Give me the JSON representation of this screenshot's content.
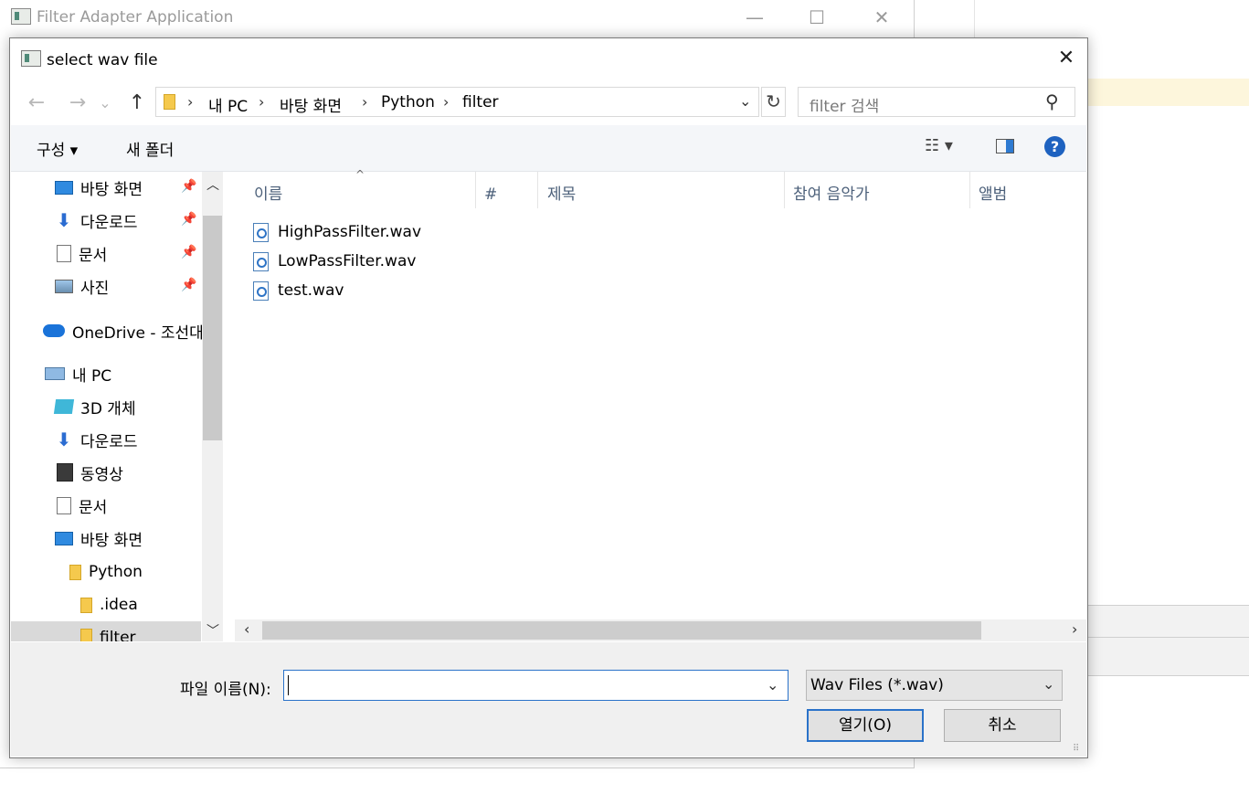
{
  "background_window": {
    "title": "Filter Adapter Application",
    "minimize": "—",
    "maximize": "☐",
    "close": "✕"
  },
  "dialog": {
    "title": "select wav file",
    "close": "✕",
    "nav": {
      "back": "←",
      "forward": "→",
      "recent": "⌄",
      "up": "↑",
      "refresh": "↻",
      "dropdown": "⌄"
    },
    "breadcrumb": [
      "내 PC",
      "바탕 화면",
      "Python",
      "filter"
    ],
    "breadcrumb_sep": "›",
    "search_placeholder": "filter 검색",
    "search_icon": "⚲",
    "toolbar": {
      "organize": "구성 ▾",
      "new_folder": "새 폴더",
      "view": "☷ ▾",
      "help": "?"
    },
    "nav_pane": {
      "quick_access": [
        {
          "label": "바탕 화면",
          "icon": "desktop-icon",
          "pinned": true
        },
        {
          "label": "다운로드",
          "icon": "download-icon",
          "pinned": true
        },
        {
          "label": "문서",
          "icon": "document-icon",
          "pinned": true
        },
        {
          "label": "사진",
          "icon": "pictures-icon",
          "pinned": true
        }
      ],
      "onedrive": "OneDrive - 조선대",
      "this_pc": "내 PC",
      "pc_items": [
        "3D 개체",
        "다운로드",
        "동영상",
        "문서",
        "바탕 화면"
      ],
      "python": "Python",
      "idea": ".idea",
      "filter": "filter",
      "pin_glyph": "📌"
    },
    "columns": [
      "이름",
      "#",
      "제목",
      "참여 음악가",
      "앨범"
    ],
    "sort_indicator": "^",
    "files": [
      "HighPassFilter.wav",
      "LowPassFilter.wav",
      "test.wav"
    ],
    "scroll": {
      "up": "︿",
      "down": "﹀",
      "left": "‹",
      "right": "›"
    },
    "file_name_label": "파일 이름(N):",
    "file_name_value": "",
    "file_type": "Wav Files (*.wav)",
    "open_button": "열기(O)",
    "cancel_button": "취소",
    "grip": "⠿"
  }
}
